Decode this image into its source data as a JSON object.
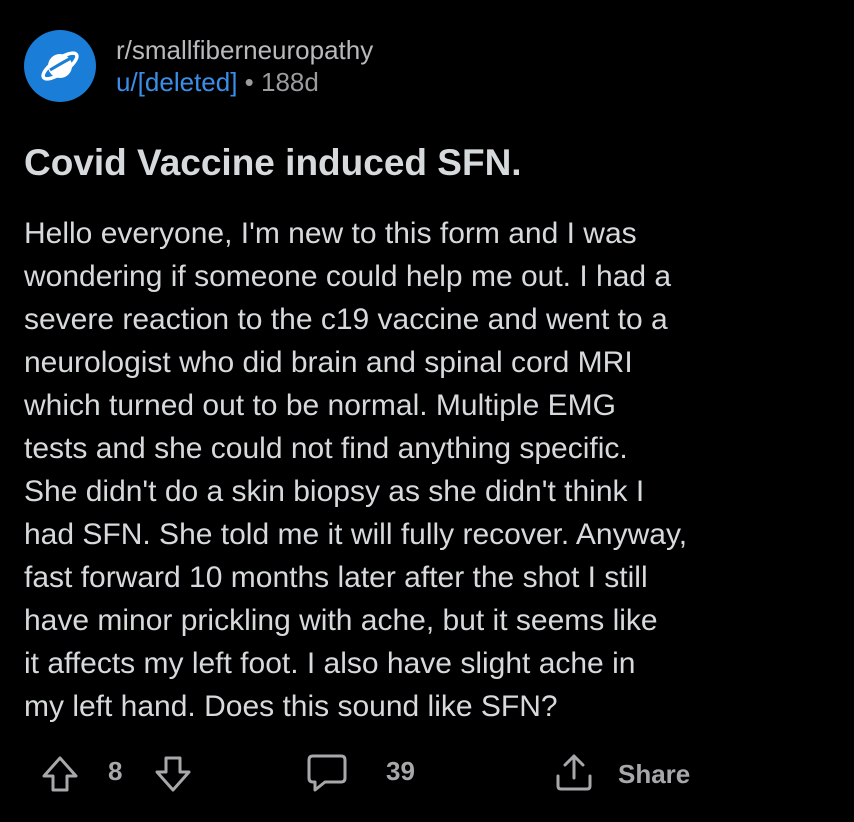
{
  "post": {
    "subreddit": "r/smallfiberneuropathy",
    "author": "u/[deleted]",
    "separator": "•",
    "age": "188d",
    "title": "Covid Vaccine induced SFN.",
    "body": "Hello everyone, I'm new to this form and I was\nwondering if someone could help me out. I had a\nsevere reaction to the c19 vaccine and went to a\nneurologist who did brain and spinal cord MRI\nwhich turned out to be normal. Multiple EMG\ntests and she could not find anything specific.\nShe didn't do a skin biopsy as she didn't think I\nhad SFN. She told me it will fully recover. Anyway,\nfast forward 10 months later after the shot I still\nhave minor prickling with ache, but it seems like\nit affects my left foot. I also have slight ache in\nmy left hand. Does this sound like SFN?"
  },
  "actions": {
    "vote_count": "8",
    "comment_count": "39",
    "share_label": "Share"
  },
  "icons": {
    "subreddit_avatar": "planet-icon",
    "upvote": "arrow-up-icon",
    "downvote": "arrow-down-icon",
    "comments": "comment-bubble-icon",
    "share": "share-icon"
  },
  "colors": {
    "background": "#000000",
    "text": "#d7dadc",
    "author_link": "#3b8ee8",
    "avatar": "#1a7dd7"
  }
}
